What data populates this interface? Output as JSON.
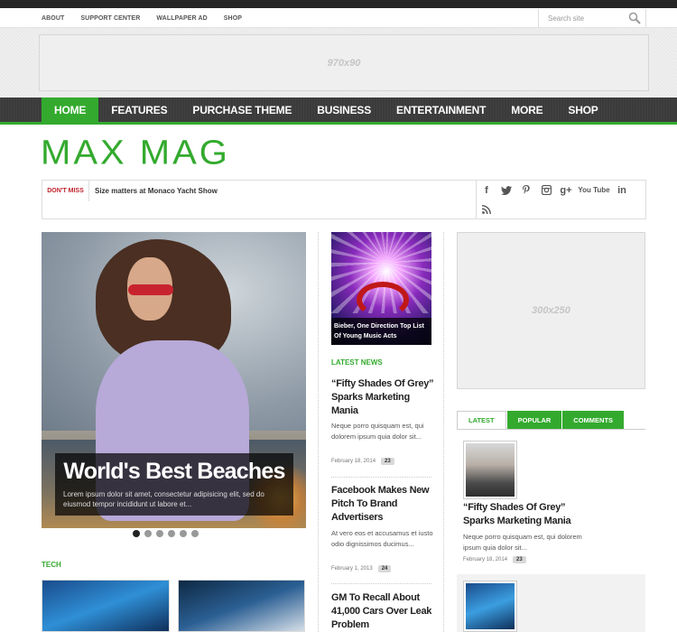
{
  "top_links": [
    "ABOUT",
    "SUPPORT CENTER",
    "WALLPAPER AD",
    "SHOP"
  ],
  "search": {
    "placeholder": "Search site"
  },
  "ads": {
    "top": "970x90",
    "side": "300x250"
  },
  "main_nav": [
    "HOME",
    "FEATURES",
    "PURCHASE THEME",
    "BUSINESS",
    "ENTERTAINMENT",
    "MORE",
    "SHOP"
  ],
  "logo": "MAX MAG",
  "dont_miss": {
    "label": "DON'T MISS",
    "text": "Size matters at Monaco Yacht Show"
  },
  "social": [
    "facebook-icon",
    "twitter-icon",
    "pinterest-icon",
    "instagram-icon",
    "googleplus-icon",
    "youtube-icon",
    "linkedin-icon",
    "rss-icon"
  ],
  "social_labels": {
    "f": "f",
    "gplus": "g+",
    "youtube": "You Tube",
    "in": "in"
  },
  "slider": {
    "title": "World's Best Beaches",
    "text": "Lorem ipsum dolor sit amet, consectetur adipisicing elit, sed do eiusmod tempor incididunt ut labore et..."
  },
  "sections": {
    "tech": "TECH",
    "latest_news": "LATEST NEWS"
  },
  "feature": {
    "caption": "Bieber, One Direction Top List Of Young Music Acts"
  },
  "news": [
    {
      "title": "“Fifty Shades Of Grey” Sparks Marketing Mania",
      "excerpt": "Neque porro quisquam est, qui dolorem ipsum quia dolor sit...",
      "date": "February 18, 2014",
      "comments": "23"
    },
    {
      "title": "Facebook Makes New Pitch To Brand Advertisers",
      "excerpt": "At vero eos et accusamus et iusto odio dignissimos ducimus...",
      "date": "February 1, 2013",
      "comments": "24"
    },
    {
      "title": "GM To Recall About 41,000 Cars Over Leak Problem"
    }
  ],
  "tabs": [
    "LATEST",
    "POPULAR",
    "COMMENTS"
  ],
  "side_post": {
    "title": "“Fifty Shades Of Grey” Sparks Marketing Mania",
    "excerpt": "Neque porro quisquam est, qui dolorem ipsum quia dolor sit...",
    "date": "February 18, 2014",
    "comments": "23"
  },
  "colors": {
    "accent": "#33aa2e",
    "nav_bg": "#3b3b3b",
    "dont_miss": "#c0202a"
  }
}
